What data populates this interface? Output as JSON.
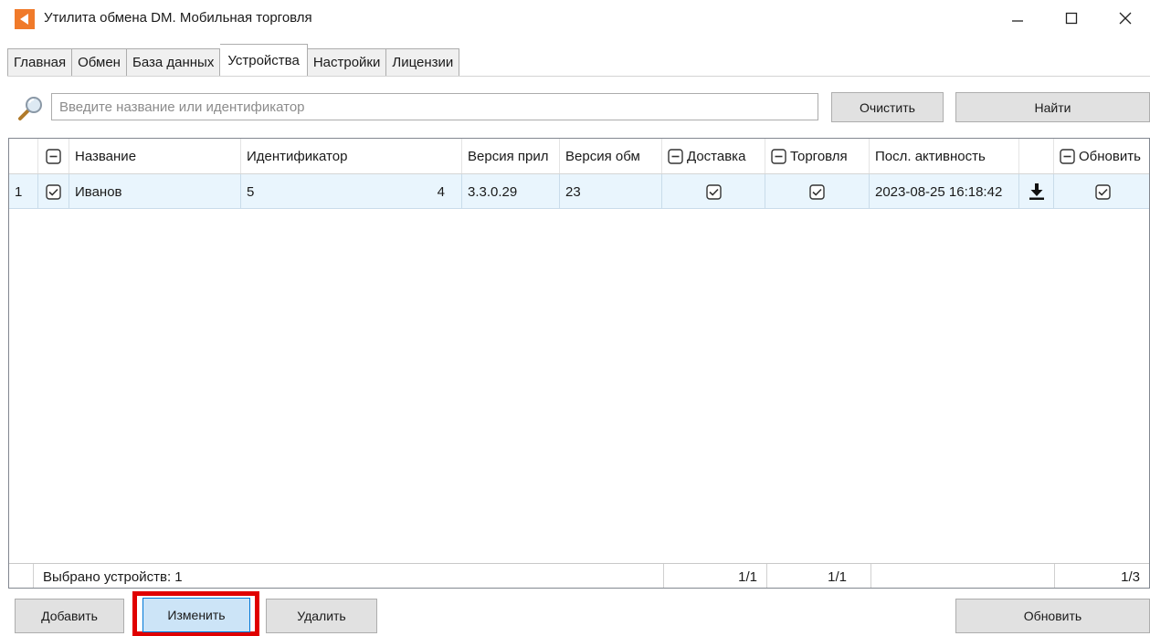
{
  "window": {
    "title": "Утилита обмена DM. Мобильная торговля"
  },
  "tabs": [
    {
      "label": "Главная"
    },
    {
      "label": "Обмен"
    },
    {
      "label": "База данных"
    },
    {
      "label": "Устройства",
      "active": true
    },
    {
      "label": "Настройки"
    },
    {
      "label": "Лицензии"
    }
  ],
  "search": {
    "placeholder": "Введите название или идентификатор",
    "value": ""
  },
  "buttons": {
    "clear": "Очистить",
    "find": "Найти",
    "add": "Добавить",
    "edit": "Изменить",
    "delete": "Удалить",
    "refresh": "Обновить"
  },
  "table": {
    "headers": {
      "name": "Название",
      "identifier": "Идентификатор",
      "app_version": "Версия прил",
      "exchange_version": "Версия обм",
      "delivery": "Доставка",
      "trade": "Торговля",
      "last_activity": "Посл. активность",
      "update": "Обновить"
    },
    "rows": [
      {
        "index": "1",
        "selected": true,
        "name": "Иванов",
        "identifier": "5",
        "identifier_count": "4",
        "app_version": "3.3.0.29",
        "exchange_version": "23",
        "delivery": true,
        "trade": true,
        "last_activity": "2023-08-25 16:18:42",
        "update": true
      }
    ],
    "footer": {
      "selected_devices": "Выбрано устройств: 1",
      "delivery_count": "1/1",
      "trade_count": "1/1",
      "update_count": "1/3"
    }
  },
  "colors": {
    "accent": "#0078d7",
    "highlight_frame": "#e00000",
    "row_selected": "#e9f5fd",
    "app_icon": "#f07a2a"
  },
  "icons": {
    "app": "app-logo-icon",
    "search": "magnifier-icon",
    "download": "download-icon"
  }
}
